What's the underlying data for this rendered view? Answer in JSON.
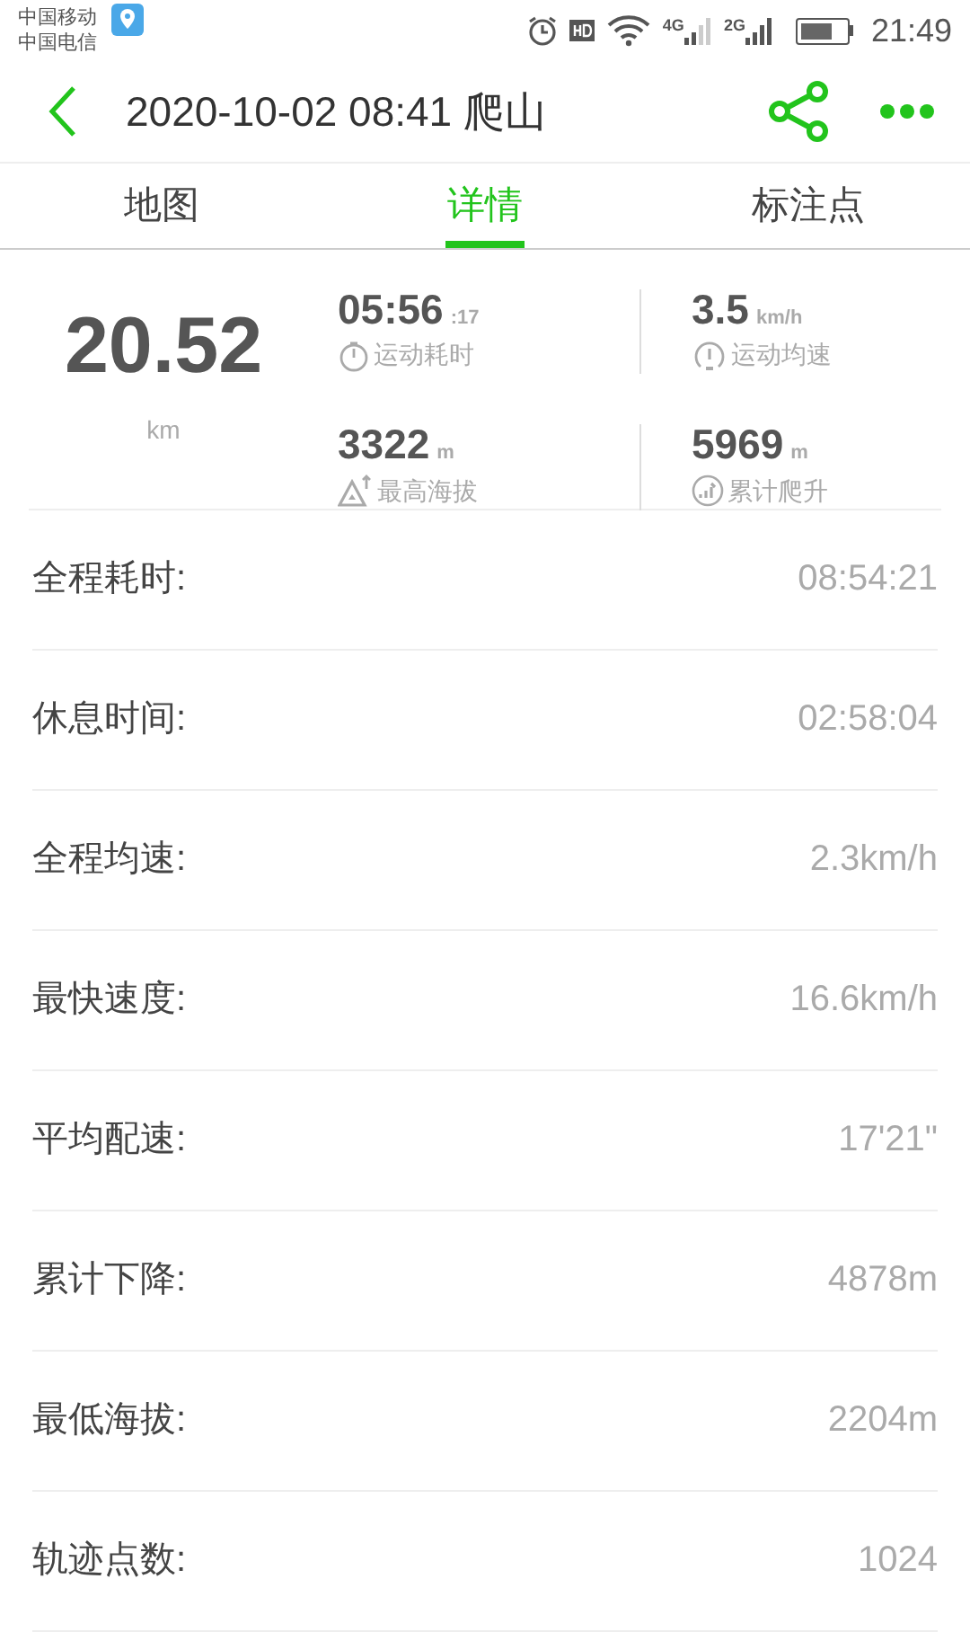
{
  "status_bar": {
    "carriers": [
      "中国移动",
      "中国电信"
    ],
    "network_1": "4G",
    "network_2": "2G",
    "time": "21:49"
  },
  "header": {
    "title": "2020-10-02 08:41 爬山"
  },
  "tabs": [
    {
      "label": "地图",
      "selected": false
    },
    {
      "label": "详情",
      "selected": true
    },
    {
      "label": "标注点",
      "selected": false
    }
  ],
  "summary": {
    "distance": "20.52",
    "distance_unit": "km",
    "stats": [
      {
        "value": "05:56",
        "unit": ":17",
        "label": "运动耗时"
      },
      {
        "value": "3.5",
        "unit": "km/h",
        "label": "运动均速"
      },
      {
        "value": "3322",
        "unit": "m",
        "label": "最高海拔"
      },
      {
        "value": "5969",
        "unit": "m",
        "label": "累计爬升"
      }
    ]
  },
  "details": [
    {
      "label": "全程耗时:",
      "value": "08:54:21"
    },
    {
      "label": "休息时间:",
      "value": "02:58:04"
    },
    {
      "label": "全程均速:",
      "value": "2.3km/h"
    },
    {
      "label": "最快速度:",
      "value": "16.6km/h"
    },
    {
      "label": "平均配速:",
      "value": "17'21\""
    },
    {
      "label": "累计下降:",
      "value": "4878m"
    },
    {
      "label": "最低海拔:",
      "value": "2204m"
    },
    {
      "label": "轨迹点数:",
      "value": "1024"
    }
  ]
}
